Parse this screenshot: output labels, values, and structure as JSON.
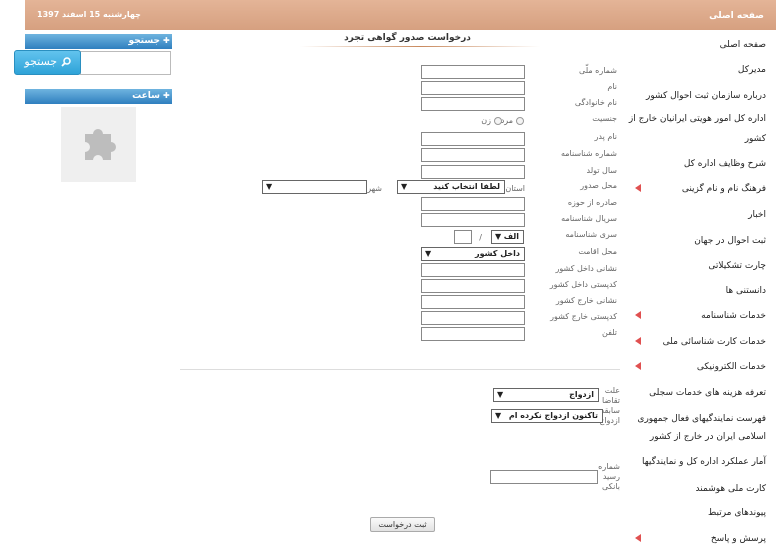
{
  "header": {
    "date": "چهارشنبه 15 اسفند 1397",
    "home": "صفحه اصلی"
  },
  "search": {
    "title": "جستجو",
    "button": "جستجو",
    "placeholder": ""
  },
  "clock": {
    "title": "ساعت"
  },
  "menu": [
    {
      "label": "صفحه اصلی",
      "arrow": false
    },
    {
      "label": "مدیرکل",
      "arrow": false
    },
    {
      "label": "درباره سازمان ثبت احوال کشور",
      "arrow": false
    },
    {
      "label": "اداره کل امور هویتی ایرانیان خارج از",
      "arrow": false
    },
    {
      "label": "کشور",
      "arrow": false
    },
    {
      "label": "شرح وظایف اداره کل",
      "arrow": false
    },
    {
      "label": "فرهنگ نام و نام گزینی",
      "arrow": true
    },
    {
      "label": "اخبار",
      "arrow": false
    },
    {
      "label": "ثبت احوال در جهان",
      "arrow": false
    },
    {
      "label": "چارت تشکیلاتی",
      "arrow": false
    },
    {
      "label": "دانستنی ها",
      "arrow": false
    },
    {
      "label": "خدمات شناسنامه",
      "arrow": true
    },
    {
      "label": "خدمات کارت شناسائی ملی",
      "arrow": true
    },
    {
      "label": "خدمات الکترونیکی",
      "arrow": true
    },
    {
      "label": "تعرفه هزینه های خدمات سجلی",
      "arrow": false
    },
    {
      "label": "فهرست نمایندگیهای فعال جمهوری",
      "arrow": false
    },
    {
      "label": "اسلامی ایران در خارج از کشور",
      "arrow": false
    },
    {
      "label": "آمار عملکرد اداره کل و نمایندگیها",
      "arrow": false
    },
    {
      "label": "کارت ملی هوشمند",
      "arrow": false
    },
    {
      "label": "پیوندهای مرتبط",
      "arrow": false
    },
    {
      "label": "پرسش و پاسخ",
      "arrow": true
    }
  ],
  "form": {
    "title": "درخواست صدور گواهی تجرد",
    "labels": {
      "national_id": "شماره ملّی",
      "first_name": "نام",
      "last_name": "نام خانوادگی",
      "gender": "جنسیت",
      "male": "مرد",
      "female": "زن",
      "father_name": "نام پدر",
      "id_number": "شماره شناسنامه",
      "birth_year": "سال تولد",
      "issue_place": "محل صدور",
      "province": "استان",
      "city": "شهر",
      "issued_from": "صادره از حوزه",
      "id_serial": "سریال شناسنامه",
      "id_series": "سری شناسنامه",
      "residence": "محل اقامت",
      "domestic_address": "نشانی داخل کشور",
      "domestic_postal": "کدپستی داخل کشور",
      "foreign_address": "نشانی خارج کشور",
      "foreign_postal": "کدپستی خارج کشور",
      "phone": "تلفن",
      "reason": "علت تقاضا",
      "marriage_history": "سابقه ازدواج",
      "receipt_number": "شماره رسید بانکی",
      "slash": "/"
    },
    "province_value": "لطفا انتخاب کنید",
    "city_value": "",
    "series_letter": "الف",
    "residence_value": "داخل کشور",
    "reason_value": "ازدواج",
    "marriage_value": "تاکنون ازدواج نکرده ام",
    "submit": "ثبت درخواست"
  },
  "colors": {
    "header": "#d9a384",
    "box_header": "#3a8ccb",
    "arrow": "#e05050"
  }
}
